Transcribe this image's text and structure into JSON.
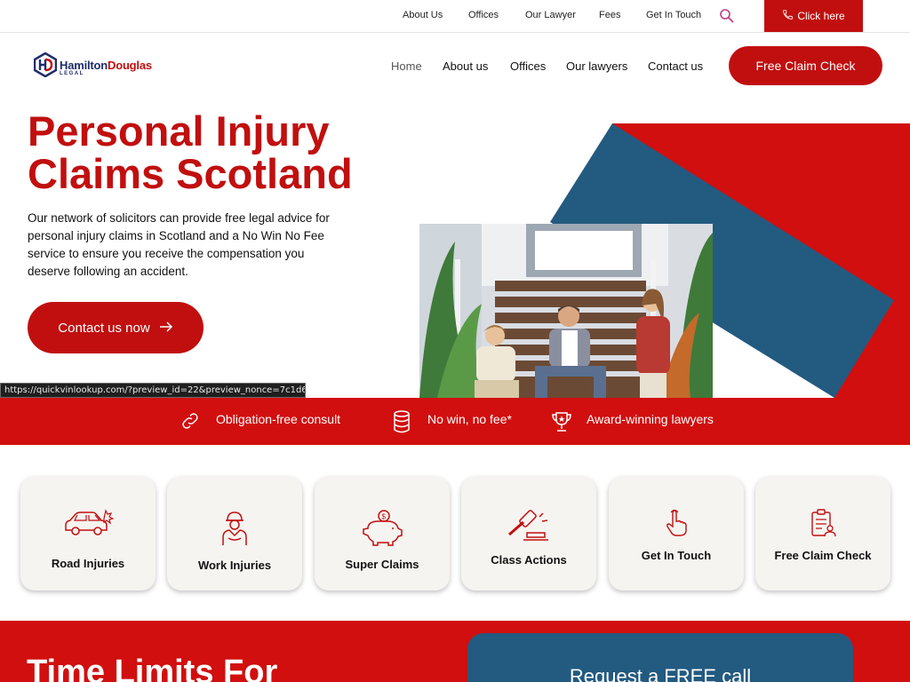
{
  "topbar": {
    "links": [
      "About Us",
      "Offices",
      "Our Lawyer",
      "Fees",
      "Get In Touch"
    ],
    "search_icon": "search-icon",
    "cta_label": "Click here",
    "cta_icon": "phone-icon"
  },
  "logo": {
    "name_part1": "Hamilton",
    "name_part2": "Douglas",
    "sub": "LEGAL"
  },
  "nav": {
    "items": [
      "Home",
      "About us",
      "Offices",
      "Our lawyers",
      "Contact us"
    ],
    "active": "Home",
    "cta_label": "Free Claim Check"
  },
  "hero": {
    "title_line1": "Personal Injury",
    "title_line2": "Claims Scotland",
    "text": "Our network of solicitors can provide free legal advice for personal injury claims in Scotland and a No Win No Fee service to ensure you receive the compensation you deserve following an accident.",
    "button_label": "Contact us now",
    "button_icon": "arrow-right-icon"
  },
  "status_url": "https://quickvinlookup.com/?preview_id=22&preview_nonce=7c1d66aceb&...",
  "features": [
    {
      "icon": "link-icon",
      "label": "Obligation-free consult"
    },
    {
      "icon": "coins-icon",
      "label": "No win, no fee*"
    },
    {
      "icon": "trophy-icon",
      "label": "Award-winning lawyers"
    }
  ],
  "services": [
    {
      "icon": "car-crash-icon",
      "label": "Road Injuries"
    },
    {
      "icon": "worker-icon",
      "label": "Work Injuries"
    },
    {
      "icon": "piggy-bank-icon",
      "label": "Super Claims"
    },
    {
      "icon": "gavel-icon",
      "label": "Class Actions"
    },
    {
      "icon": "hand-pointer-icon",
      "label": "Get In Touch"
    },
    {
      "icon": "clipboard-icon",
      "label": "Free Claim Check"
    }
  ],
  "bottom": {
    "title": "Time Limits For",
    "callbox_title": "Request a FREE call"
  },
  "colors": {
    "brand_red": "#c10f0f",
    "band_red": "#d10f0f",
    "navy": "#1f2d6b",
    "blue": "#235a80"
  }
}
